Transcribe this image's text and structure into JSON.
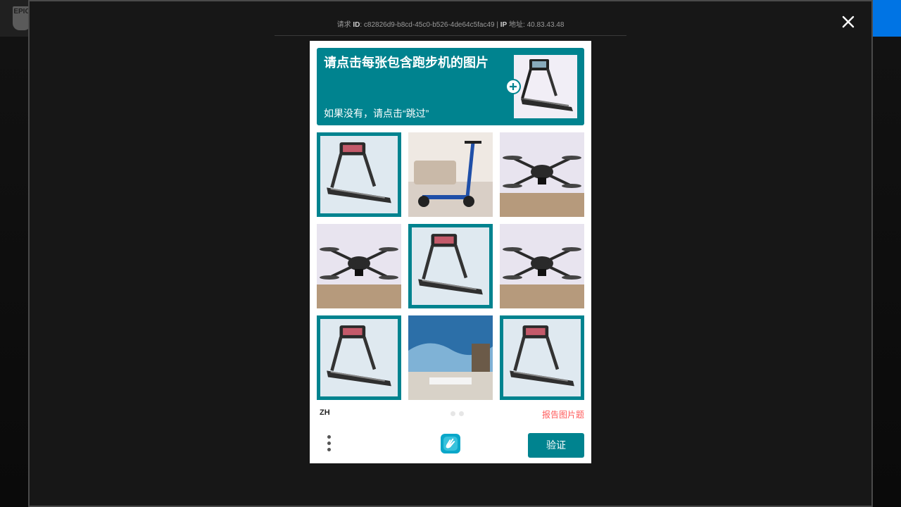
{
  "background": {
    "logo_text": "EPIC"
  },
  "ray": {
    "id_prefix": "请求",
    "id_label": "ID",
    "id_value": "c82826d9-b8cd-45c0-b526-4de64c5fac49",
    "separator": " | ",
    "ip_label": "IP",
    "ip_suffix": "地址",
    "ip_value": "40.83.43.48"
  },
  "captcha": {
    "prompt_title": "请点击每张包含跑步机的图片",
    "prompt_subtitle": "如果没有，请点击“跳过”",
    "tiles": [
      {
        "icon": "treadmill-icon",
        "selected": true
      },
      {
        "icon": "scooter-icon",
        "selected": false
      },
      {
        "icon": "drone-icon",
        "selected": false
      },
      {
        "icon": "drone-icon",
        "selected": false
      },
      {
        "icon": "treadmill-icon",
        "selected": true
      },
      {
        "icon": "drone-icon",
        "selected": false
      },
      {
        "icon": "treadmill-icon",
        "selected": true
      },
      {
        "icon": "living-room-icon",
        "selected": false
      },
      {
        "icon": "treadmill-icon",
        "selected": true
      }
    ],
    "language": "ZH",
    "report_label": "报告图片题",
    "verify_label": "验证"
  },
  "colors": {
    "accent": "#00838f",
    "report": "#ff5a5a"
  }
}
